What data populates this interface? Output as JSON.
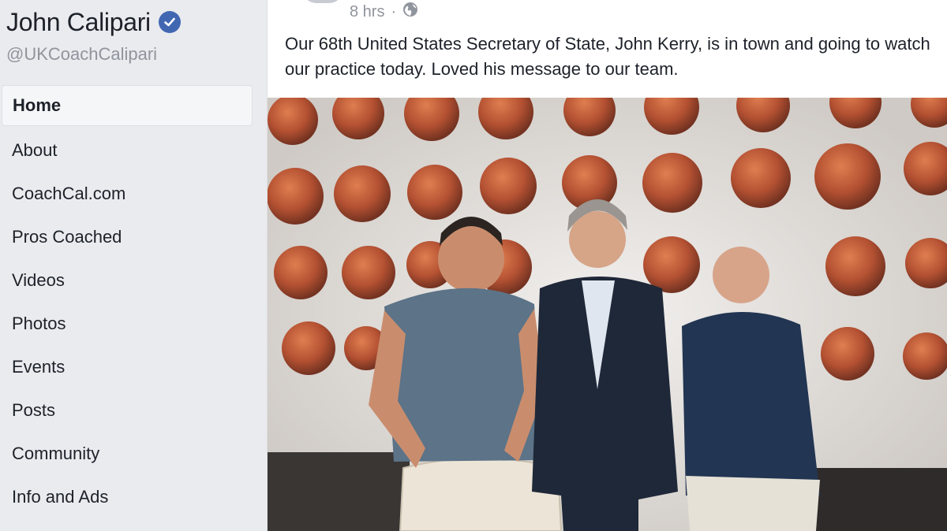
{
  "page": {
    "name": "John Calipari",
    "handle": "@UKCoachCalipari"
  },
  "nav": {
    "items": [
      {
        "label": "Home",
        "active": true
      },
      {
        "label": "About"
      },
      {
        "label": "CoachCal.com"
      },
      {
        "label": "Pros Coached"
      },
      {
        "label": "Videos"
      },
      {
        "label": "Photos"
      },
      {
        "label": "Events"
      },
      {
        "label": "Posts"
      },
      {
        "label": "Community"
      },
      {
        "label": "Info and Ads"
      }
    ]
  },
  "post": {
    "time": "8 hrs",
    "separator": "·",
    "privacy_icon": "globe-icon",
    "text": "Our 68th United States Secretary of State, John Kerry, is in town and going to watch our practice today. Loved his message to our team."
  },
  "colors": {
    "brand": "#4267b2",
    "text": "#1d2129",
    "muted": "#90949c"
  }
}
